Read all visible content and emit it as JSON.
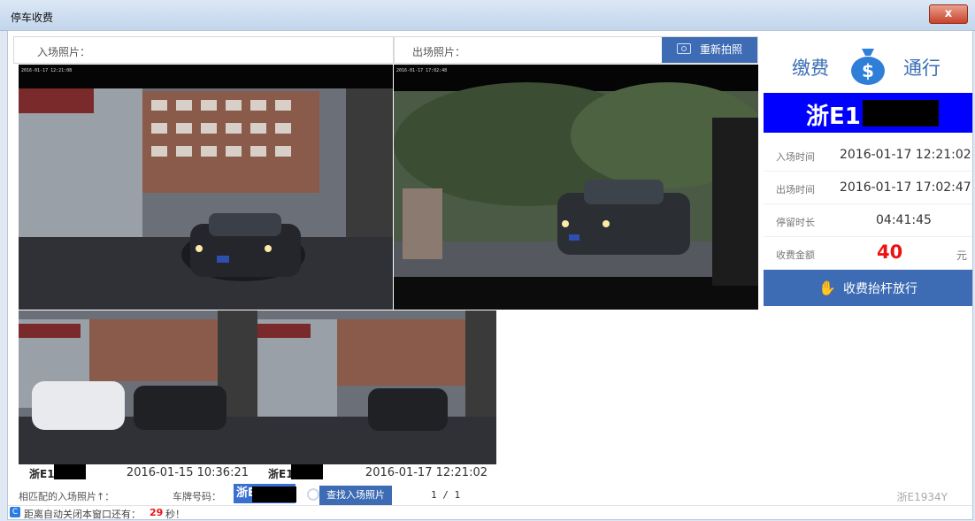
{
  "window": {
    "title": "停车收费",
    "close_label": "x"
  },
  "photos": {
    "entry_label": "入场照片：",
    "exit_label": "出场照片：",
    "retake_label": "重新拍照",
    "entry_timestamp": "2016-01-17 12:21:08",
    "exit_timestamp": "2016-01-17 17:02:48"
  },
  "payment": {
    "pay_label": "缴费",
    "pass_label": "通行",
    "plate_prefix": "浙E1",
    "rows": [
      {
        "label": "入场时间",
        "value": "2016-01-17 12:21:02"
      },
      {
        "label": "出场时间",
        "value": "2016-01-17 17:02:47"
      },
      {
        "label": "停留时长",
        "value": "04:41:45"
      }
    ],
    "fee_label": "收费金额",
    "fee_amount": "40",
    "fee_unit": "元",
    "release_label": "收费抬杆放行",
    "plate_full": "浙E1934Y"
  },
  "matches": [
    {
      "plate": "浙E1",
      "datetime": "2016-01-15 10:36:21"
    },
    {
      "plate": "浙E1",
      "datetime": "2016-01-17 12:21:02"
    }
  ],
  "search": {
    "matched_label": "相匹配的入场照片↑：",
    "plate_label": "车牌号码：",
    "plate_value": "浙E1",
    "find_label": "查找入场照片",
    "pager": "1 / 1"
  },
  "status": {
    "prefix": "距离自动关闭本窗口还有：",
    "seconds": "29",
    "suffix": "秒！"
  }
}
